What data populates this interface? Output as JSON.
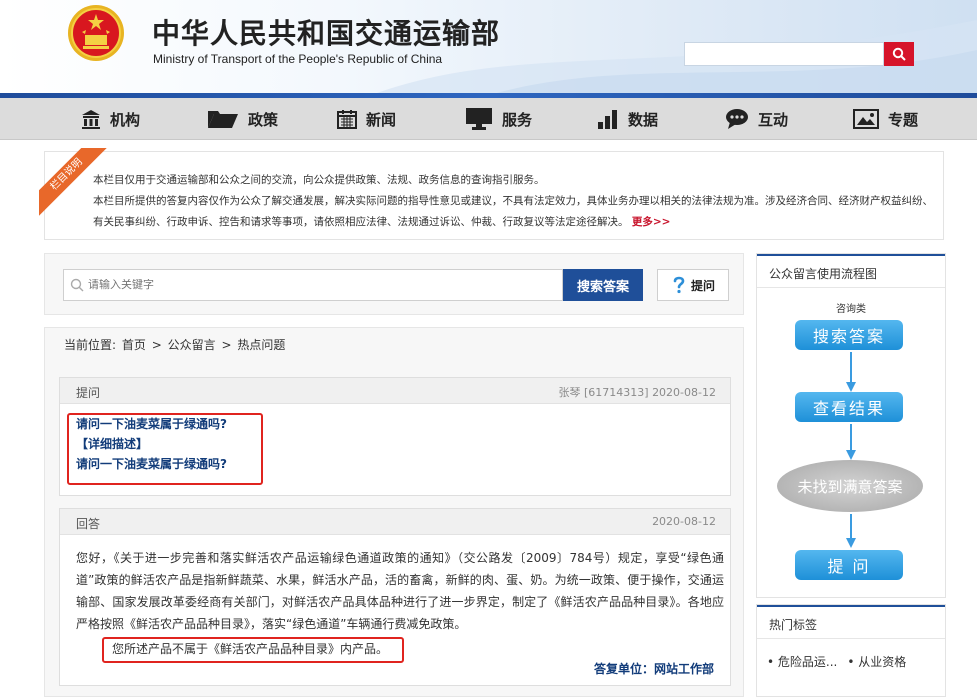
{
  "header": {
    "title_cn": "中华人民共和国交通运输部",
    "title_en": "Ministry of Transport of the People's Republic of China",
    "search_value": "",
    "accent": "#d6142a",
    "nav_blue": "#1f4f99"
  },
  "nav": {
    "items": [
      {
        "label": "机构",
        "icon": "building-icon"
      },
      {
        "label": "政策",
        "icon": "folder-icon"
      },
      {
        "label": "新闻",
        "icon": "calendar-icon"
      },
      {
        "label": "服务",
        "icon": "monitor-icon"
      },
      {
        "label": "数据",
        "icon": "bar-chart-icon"
      },
      {
        "label": "互动",
        "icon": "chat-icon"
      },
      {
        "label": "专题",
        "icon": "image-icon"
      }
    ]
  },
  "notice": {
    "ribbon": "栏目说明",
    "line1": "本栏目仅用于交通运输部和公众之间的交流，向公众提供政策、法规、政务信息的查询指引服务。",
    "line2": "本栏目所提供的答复内容仅作为公众了解交通发展，解决实际问题的指导性意见或建议，不具有法定效力，具体业务办理以相关的法律法规为准。涉及经济合同、经济财产权益纠纷、有关民事纠纷、行政申诉、控告和请求等事项，请依照相应法律、法规通过诉讼、仲裁、行政复议等法定途径解决。",
    "more": "更多>>"
  },
  "search": {
    "placeholder": "请输入关键字",
    "search_button": "搜索答案",
    "ask_button": "提问"
  },
  "breadcrumb": {
    "prefix": "当前位置:",
    "items": [
      "首页",
      "公众留言",
      "热点问题"
    ],
    "separator": ">"
  },
  "question": {
    "label": "提问",
    "author": "张琴",
    "id": "[61714313]",
    "date": "2020-08-12",
    "title": "请问一下油麦菜属于绿通吗?",
    "detail_label": "【详细描述】",
    "detail": "请问一下油麦菜属于绿通吗?"
  },
  "answer": {
    "label": "回答",
    "date": "2020-08-12",
    "body": "您好，《关于进一步完善和落实鲜活农产品运输绿色通道政策的通知》（交公路发〔2009〕784号）规定，享受“绿色通道”政策的鲜活农产品是指新鲜蔬菜、水果，鲜活水产品，活的畜禽，新鲜的肉、蛋、奶。为统一政策、便于操作，交通运输部、国家发展改革委经商有关部门，对鲜活农产品具体品种进行了进一步界定，制定了《鲜活农产品品种目录》。各地应严格按照《鲜活农产品品种目录》，落实“绿色通道”车辆通行费减免政策。",
    "conclusion": "您所述产品不属于《鲜活农产品品种目录》内产品。",
    "unit": "答复单位：网站工作部"
  },
  "flow": {
    "title": "公众留言使用流程图",
    "sub": "咨询类",
    "step1": "搜索答案",
    "step2": "查看结果",
    "step3": "未找到满意答案",
    "step4": "提 问"
  },
  "tags": {
    "title": "热门标签",
    "items": [
      "• 危险品运...",
      "• 从业资格"
    ]
  }
}
